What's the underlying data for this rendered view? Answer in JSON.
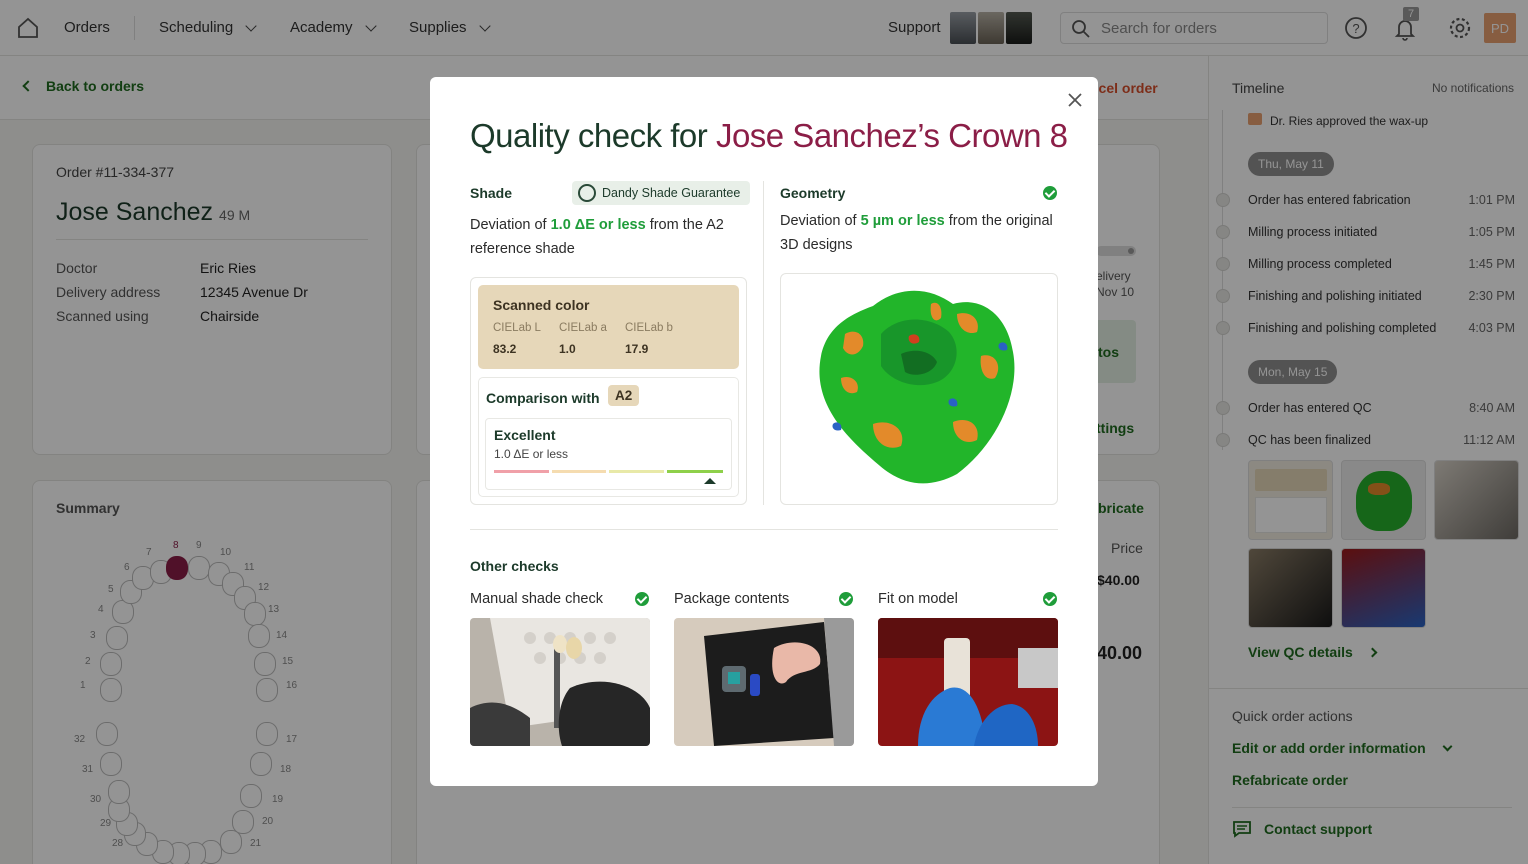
{
  "nav": {
    "orders": "Orders",
    "scheduling": "Scheduling",
    "academy": "Academy",
    "supplies": "Supplies",
    "support": "Support",
    "search_placeholder": "Search for orders",
    "notif_count": "7",
    "user_initials": "PD"
  },
  "subbar": {
    "back": "Back to orders",
    "cancel": "ncel order"
  },
  "order": {
    "number": "Order #11-334-377",
    "patient_name": "Jose Sanchez",
    "patient_meta": "49 M",
    "fields": [
      {
        "label": "Doctor",
        "value": "Eric Ries"
      },
      {
        "label": "Delivery address",
        "value": "12345 Avenue Dr"
      },
      {
        "label": "Scanned using",
        "value": "Chairside"
      }
    ]
  },
  "summary": {
    "title": "Summary",
    "selected_tooth": "8"
  },
  "background_fragments": {
    "delivery": "elivery",
    "delivery_date": "Nov 10",
    "photos": "tos",
    "settings": "ttings",
    "refabricate": "bricate",
    "price_label": "Price",
    "price": "$40.00",
    "total": "40.00"
  },
  "timeline": {
    "title": "Timeline",
    "notifications": "No notifications",
    "top_event": "Dr. Ries approved the wax-up",
    "days": [
      {
        "label": "Thu, May 11",
        "events": [
          {
            "text": "Order has entered fabrication",
            "time": "1:01 PM"
          },
          {
            "text": "Milling process initiated",
            "time": "1:05 PM"
          },
          {
            "text": "Milling process completed",
            "time": "1:45 PM"
          },
          {
            "text": "Finishing and polishing initiated",
            "time": "2:30 PM"
          },
          {
            "text": "Finishing and polishing completed",
            "time": "4:03 PM"
          }
        ]
      },
      {
        "label": "Mon, May 15",
        "events": [
          {
            "text": "Order has entered QC",
            "time": "8:40 AM"
          },
          {
            "text": "QC has been finalized",
            "time": "11:12 AM"
          }
        ]
      }
    ],
    "view_qc": "View QC details"
  },
  "quick_actions": {
    "title": "Quick order actions",
    "edit": "Edit or add order information",
    "refabricate": "Refabricate order",
    "contact": "Contact support"
  },
  "modal": {
    "title_prefix": "Quality check for",
    "title_name": "Jose Sanchez’s Crown 8",
    "shade": {
      "heading": "Shade",
      "guarantee": "Dandy Shade Guarantee",
      "desc_pre": "Deviation of",
      "desc_value": "1.0 ΔE or less",
      "desc_post": "from the A2 reference shade",
      "scanned_title": "Scanned color",
      "cielab": [
        {
          "label": "CIELab L",
          "value": "83.2"
        },
        {
          "label": "CIELab a",
          "value": "1.0"
        },
        {
          "label": "CIELab b",
          "value": "17.9"
        }
      ],
      "comparison_label": "Comparison with",
      "comparison_shade": "A2",
      "rating": "Excellent",
      "rating_detail": "1.0 ΔE or less"
    },
    "geometry": {
      "heading": "Geometry",
      "desc_pre": "Deviation of",
      "desc_value": "5 µm or less",
      "desc_post": "from the original 3D designs"
    },
    "other_checks": {
      "heading": "Other checks",
      "items": [
        "Manual shade check",
        "Package contents",
        "Fit on model"
      ]
    },
    "colors": {
      "title": "#1c3a2a",
      "name": "#8b1e47",
      "check": "#1f9d3a"
    }
  }
}
